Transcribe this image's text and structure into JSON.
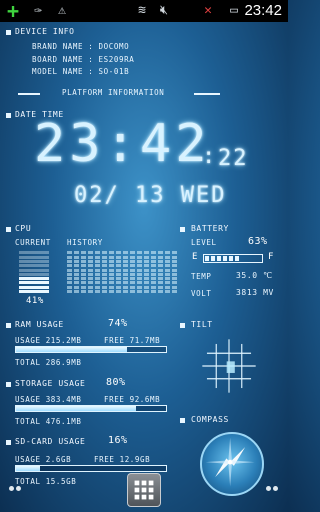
{
  "statusbar": {
    "time": "23:42",
    "icons": [
      "add-icon",
      "usb-debug-icon",
      "warning-icon",
      "wifi-icon",
      "mute-icon",
      "no-signal-icon",
      "battery-icon"
    ]
  },
  "device_info": {
    "title": "DEVICE INFO",
    "brand": "BRAND NAME : DOCOMO",
    "board": "BOARD NAME : ES209RA",
    "model": "MODEL NAME : SO-01B"
  },
  "platform": {
    "title": "PLATFORM INFORMATION"
  },
  "datetime": {
    "title": "DATE TIME",
    "time": "23:42",
    "seconds": "22",
    "date": "02/ 13 WED"
  },
  "cpu": {
    "title": "CPU",
    "current_label": "CURRENT",
    "history_label": "HISTORY",
    "percent": "41%",
    "level": 0.41
  },
  "battery": {
    "title": "BATTERY",
    "level_label": "LEVEL",
    "level_value": "63%",
    "level": 0.63,
    "empty_label": "E",
    "full_label": "F",
    "temp_label": "TEMP",
    "temp_value": "35.0 ℃",
    "volt_label": "VOLT",
    "volt_value": "3813 MV"
  },
  "ram": {
    "title": "RAM USAGE",
    "percent": "74%",
    "usage": "USAGE 215.2MB",
    "free": "FREE 71.7MB",
    "total": "TOTAL 286.9MB",
    "level": 0.74
  },
  "storage": {
    "title": "STORAGE USAGE",
    "percent": "80%",
    "usage": "USAGE 383.4MB",
    "free": "FREE 92.6MB",
    "total": "TOTAL 476.1MB",
    "level": 0.8
  },
  "sdcard": {
    "title": "SD-CARD USAGE",
    "percent": "16%",
    "usage": "USAGE 2.6GB",
    "free": "FREE 12.9GB",
    "total": "TOTAL 15.5GB",
    "level": 0.16
  },
  "tilt": {
    "title": "TILT"
  },
  "compass": {
    "title": "COMPASS"
  },
  "colors": {
    "background": "#1d5f94",
    "accent": "#e8f6ff",
    "statusbar": "#000000"
  }
}
